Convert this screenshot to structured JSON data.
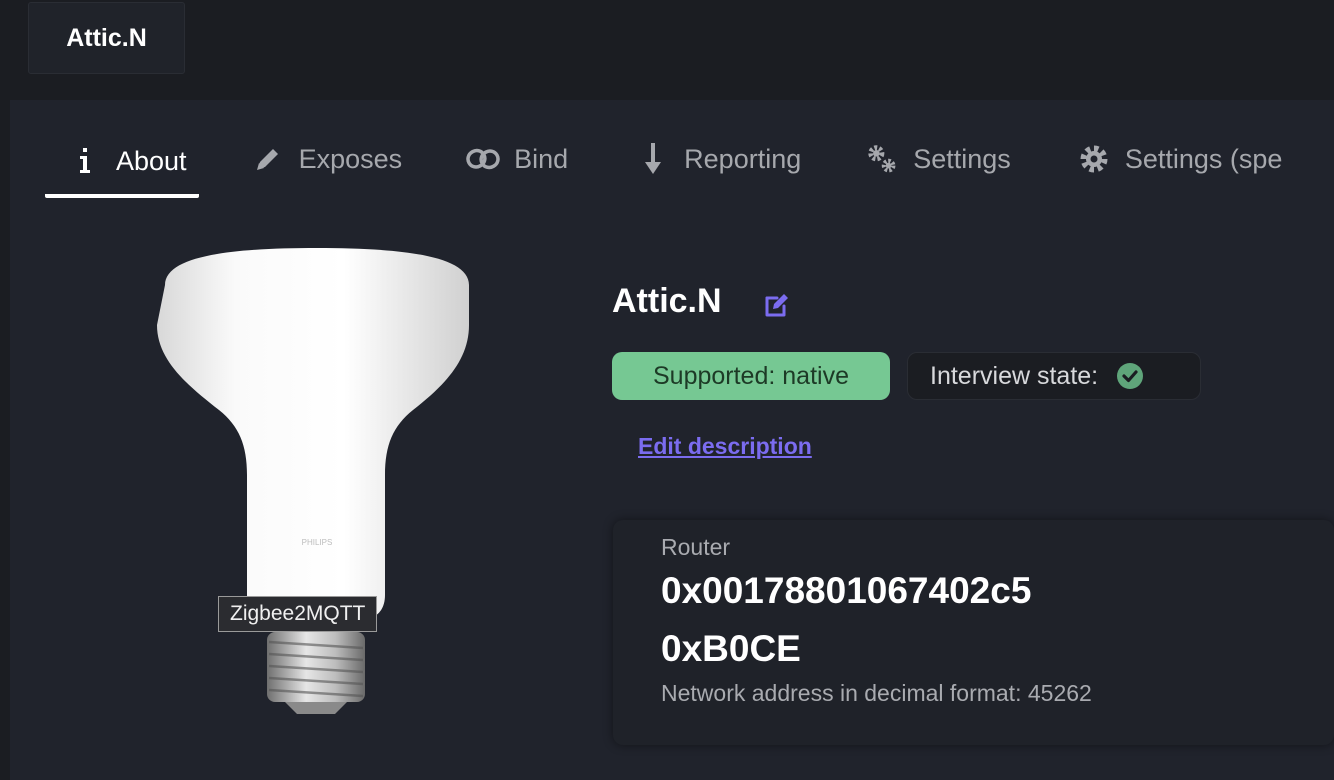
{
  "header": {
    "title": "Attic.N"
  },
  "tabs": [
    {
      "label": "About",
      "icon": "info-icon",
      "active": true
    },
    {
      "label": "Exposes",
      "icon": "pencil-icon",
      "active": false
    },
    {
      "label": "Bind",
      "icon": "link-icon",
      "active": false
    },
    {
      "label": "Reporting",
      "icon": "arrow-down-icon",
      "active": false
    },
    {
      "label": "Settings",
      "icon": "cogs-icon",
      "active": false
    },
    {
      "label": "Settings (spe",
      "icon": "gear-icon",
      "active": false
    }
  ],
  "device": {
    "name": "Attic.N",
    "image_tooltip": "Zigbee2MQTT",
    "supported_badge": "Supported: native",
    "interview_label": "Interview state:",
    "edit_description": "Edit description",
    "type": "Router",
    "ieee_address": "0x00178801067402c5",
    "network_address": "0xB0CE",
    "network_decimal": "Network address in decimal format: 45262"
  },
  "colors": {
    "accent": "#7b6cf0",
    "supported_bg": "#76c893",
    "background": "#1b1d22",
    "panel": "#20232c"
  }
}
